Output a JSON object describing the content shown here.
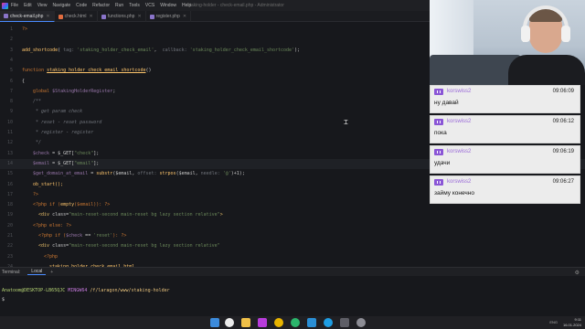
{
  "menubar": {
    "items": [
      "File",
      "Edit",
      "View",
      "Navigate",
      "Code",
      "Refactor",
      "Run",
      "Tools",
      "VCS",
      "Window",
      "Help"
    ],
    "window_title": "staking-holder - check-email.php - Administrator"
  },
  "tabs": [
    {
      "label": "check-email.php",
      "active": true,
      "color": "#8a74c9"
    },
    {
      "label": "check.html",
      "active": false,
      "color": "#e06c3f"
    },
    {
      "label": "functions.php",
      "active": false,
      "color": "#8a74c9"
    },
    {
      "label": "register.php",
      "active": false,
      "color": "#8a74c9"
    }
  ],
  "editor": {
    "line_numbers": [
      "1",
      "2",
      "3",
      "4",
      "5",
      "6",
      "7",
      "8",
      "9",
      "10",
      "11",
      "12",
      "13",
      "14",
      "15",
      "16",
      "17",
      "18",
      "19",
      "20",
      "21",
      "22",
      "23",
      "24"
    ],
    "lines": {
      "l1": "?>",
      "l3_fn": "add_shortcode",
      "l3_hint1": "tag: ",
      "l3_str1": "'staking_holder_check_email'",
      "l3_hint2": "callback: ",
      "l3_str2": "'staking_holder_check_email_shortcode'",
      "l3_end": ");",
      "l5_kw": "function ",
      "l5_fn": "staking_holder_check_email_shortcode",
      "l5_end": "()",
      "l6": "{",
      "l7_kw": "global ",
      "l7_var": "$StakingHolderRegister",
      "l7_end": ";",
      "l8": "/**",
      "l9": " * get param check",
      "l10": " * reset - reset password",
      "l11": " * register - register",
      "l12": " */",
      "l13_var": "$check",
      "l13_mid": " = $_GET[",
      "l13_str": "\"check\"",
      "l13_end": "];",
      "l14_var": "$email",
      "l14_mid": " = $_GET[",
      "l14_str": "\"email\"",
      "l14_end": "];",
      "l15_var": "$get_domain_at_email",
      "l15_mid": " = ",
      "l15_fn": "substr",
      "l15_a": "($email, ",
      "l15_hint1": "offset: ",
      "l15_fn2": "strpos",
      "l15_b": "($email, ",
      "l15_hint2": "needle: ",
      "l15_str": "'@'",
      "l15_end": ")+1);",
      "l16": "ob_start();",
      "l17": "?>",
      "l18_a": "<?php if (",
      "l18_fn": "empty",
      "l18_b": "($email)): ?>",
      "l19_tag": "<div ",
      "l19_attr": "class=",
      "l19_str": "\"main-reset-second main-reset bg lazy section relative\"",
      "l19_end": ">",
      "l20": "<?php else: ?>",
      "l21_a": "<?php if (",
      "l21_var": "$check",
      "l21_b": " == ",
      "l21_str": "'reset'",
      "l21_end": "): ?>",
      "l22_tag": "<div ",
      "l22_attr": "class=",
      "l22_str": "\"main-reset-second main-reset bg lazy section relative\"",
      "l23": "<?php",
      "l24": "staking_holder_check_email_html"
    }
  },
  "terminal": {
    "label": "Terminal:",
    "tab": "Local",
    "prompt_user": "Anatoom@DESKTOP-LB65QJC",
    "prompt_host": "MINGW64",
    "prompt_path": "/f/laragon/www/staking-holder",
    "cursor": "$"
  },
  "chat": [
    {
      "user": "korswiss2",
      "time": "09:06:09",
      "text": "ну давай"
    },
    {
      "user": "korswiss2",
      "time": "09:06:12",
      "text": "пока"
    },
    {
      "user": "korswiss2",
      "time": "09:06:19",
      "text": "удачи"
    },
    {
      "user": "korswiss2",
      "time": "09:06:27",
      "text": "займу конечно"
    }
  ],
  "taskbar": {
    "time": "9:11",
    "date": "16.01.2024",
    "lang": "ENG",
    "icons": [
      "windows-start",
      "search",
      "file-explorer",
      "phpstorm",
      "chrome",
      "edge",
      "vscode",
      "git-bash",
      "settings"
    ],
    "colors": {
      "phpstorm": "#b83cdb",
      "chrome": "#e8b400",
      "edge": "#1e9de3",
      "vscode": "#2a8fd6"
    }
  }
}
